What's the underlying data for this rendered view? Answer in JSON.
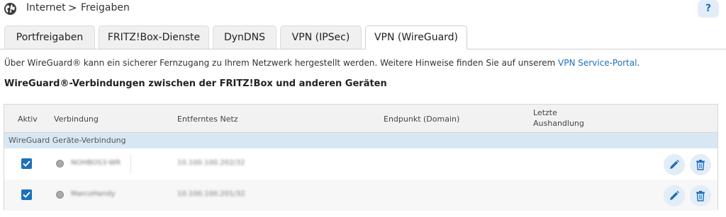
{
  "breadcrumb": {
    "section": "Internet",
    "separator": ">",
    "page": "Freigaben"
  },
  "help_label": "?",
  "tabs": [
    {
      "label": "Portfreigaben"
    },
    {
      "label": "FRITZ!Box-Dienste"
    },
    {
      "label": "DynDNS"
    },
    {
      "label": "VPN (IPSec)"
    },
    {
      "label": "VPN (WireGuard)",
      "active": true
    }
  ],
  "intro": {
    "text": "Über WireGuard® kann ein sicherer Fernzugang zu Ihrem Netzwerk hergestellt werden. Weitere Hinweise finden Sie auf unserem ",
    "link": "VPN Service-Portal",
    "suffix": "."
  },
  "heading": "WireGuard®-Verbindungen zwischen der FRITZ!Box und anderen Geräten",
  "table": {
    "columns": {
      "active": "Aktiv",
      "connection": "Verbindung",
      "remote_net": "Entferntes Netz",
      "endpoint": "Endpunkt (Domain)",
      "last_handshake_1": "Letzte",
      "last_handshake_2": "Aushandlung"
    },
    "group_label": "WireGuard Geräte-Verbindung",
    "rows": [
      {
        "active": true,
        "name": "NOHBOS3-WR",
        "remote_net": "10.100.100.202/32"
      },
      {
        "active": true,
        "name": "MarcoHandy",
        "remote_net": "10.100.100.201/32"
      }
    ]
  },
  "colors": {
    "accent": "#1c70bd",
    "group_bg": "#d8e7f4",
    "button_bg": "#e3edf8"
  },
  "icons": {
    "globe": "globe-icon",
    "edit": "pencil-icon",
    "delete": "trash-icon"
  }
}
